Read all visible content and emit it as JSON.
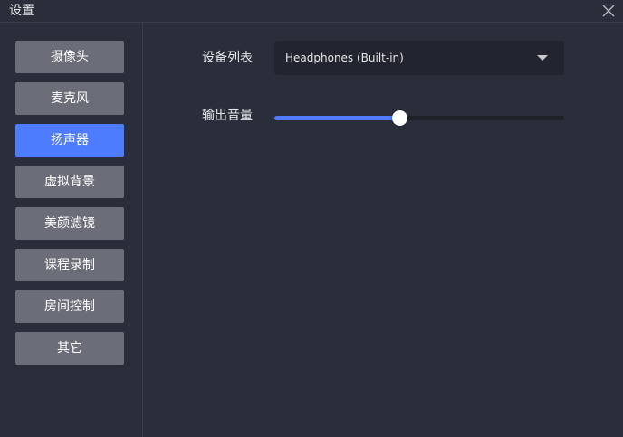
{
  "window": {
    "title": "设置"
  },
  "sidebar": {
    "items": [
      {
        "label": "摄像头",
        "active": false
      },
      {
        "label": "麦克风",
        "active": false
      },
      {
        "label": "扬声器",
        "active": true
      },
      {
        "label": "虚拟背景",
        "active": false
      },
      {
        "label": "美颜滤镜",
        "active": false
      },
      {
        "label": "课程录制",
        "active": false
      },
      {
        "label": "房间控制",
        "active": false
      },
      {
        "label": "其它",
        "active": false
      }
    ]
  },
  "speaker": {
    "device_label": "设备列表",
    "device_value": "Headphones (Built-in)",
    "volume_label": "输出音量",
    "volume_fraction": 0.43
  },
  "colors": {
    "accent": "#4d7cfe",
    "background": "#2a2d3a",
    "nav_inactive": "#6b6e78"
  },
  "icons": {
    "close": "close-icon",
    "dropdown": "chevron-down-icon"
  }
}
